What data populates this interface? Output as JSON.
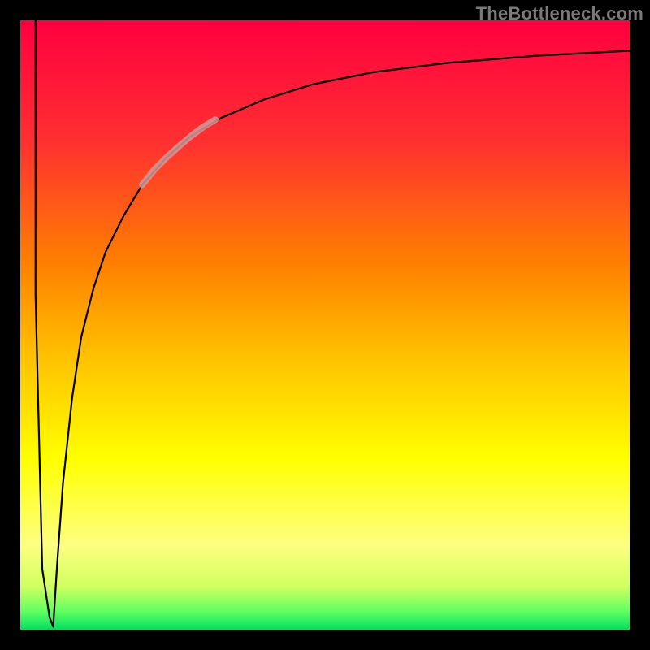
{
  "attribution": "TheBottleneck.com",
  "chart_data": {
    "type": "line",
    "title": "",
    "xlabel": "",
    "ylabel": "",
    "xlim": [
      0,
      100
    ],
    "ylim": [
      0,
      100
    ],
    "grid": false,
    "legend": false,
    "background_gradient": {
      "orientation": "vertical",
      "stops": [
        {
          "offset": 0.0,
          "color": "#ff0040"
        },
        {
          "offset": 0.2,
          "color": "#ff3030"
        },
        {
          "offset": 0.4,
          "color": "#ff8000"
        },
        {
          "offset": 0.55,
          "color": "#ffc000"
        },
        {
          "offset": 0.72,
          "color": "#ffff00"
        },
        {
          "offset": 0.86,
          "color": "#ffff80"
        },
        {
          "offset": 0.93,
          "color": "#d0ff60"
        },
        {
          "offset": 0.97,
          "color": "#60ff60"
        },
        {
          "offset": 1.0,
          "color": "#00e060"
        }
      ]
    },
    "series": [
      {
        "name": "left-spike",
        "color": "#000000",
        "width": 2.2,
        "x": [
          2.5,
          2.5,
          3.6,
          4.8,
          5.4
        ],
        "y": [
          100,
          55,
          10,
          2,
          0.5
        ]
      },
      {
        "name": "main-curve",
        "color": "#000000",
        "width": 2.2,
        "x": [
          5.4,
          6.0,
          7.0,
          8.5,
          10,
          12,
          14,
          17,
          20,
          24,
          28,
          33,
          40,
          48,
          58,
          70,
          85,
          100
        ],
        "y": [
          0.5,
          10,
          24,
          38,
          48,
          56,
          62,
          68,
          73,
          77.5,
          81,
          84,
          87,
          89.5,
          91.5,
          93,
          94.2,
          95
        ]
      },
      {
        "name": "highlight-segment",
        "color": "#d39a9a",
        "width": 8,
        "opacity": 0.85,
        "x": [
          20,
          22,
          24,
          26,
          28,
          30,
          32
        ],
        "y": [
          73,
          75.5,
          77.5,
          79.3,
          81,
          82.5,
          83.7
        ]
      }
    ]
  }
}
